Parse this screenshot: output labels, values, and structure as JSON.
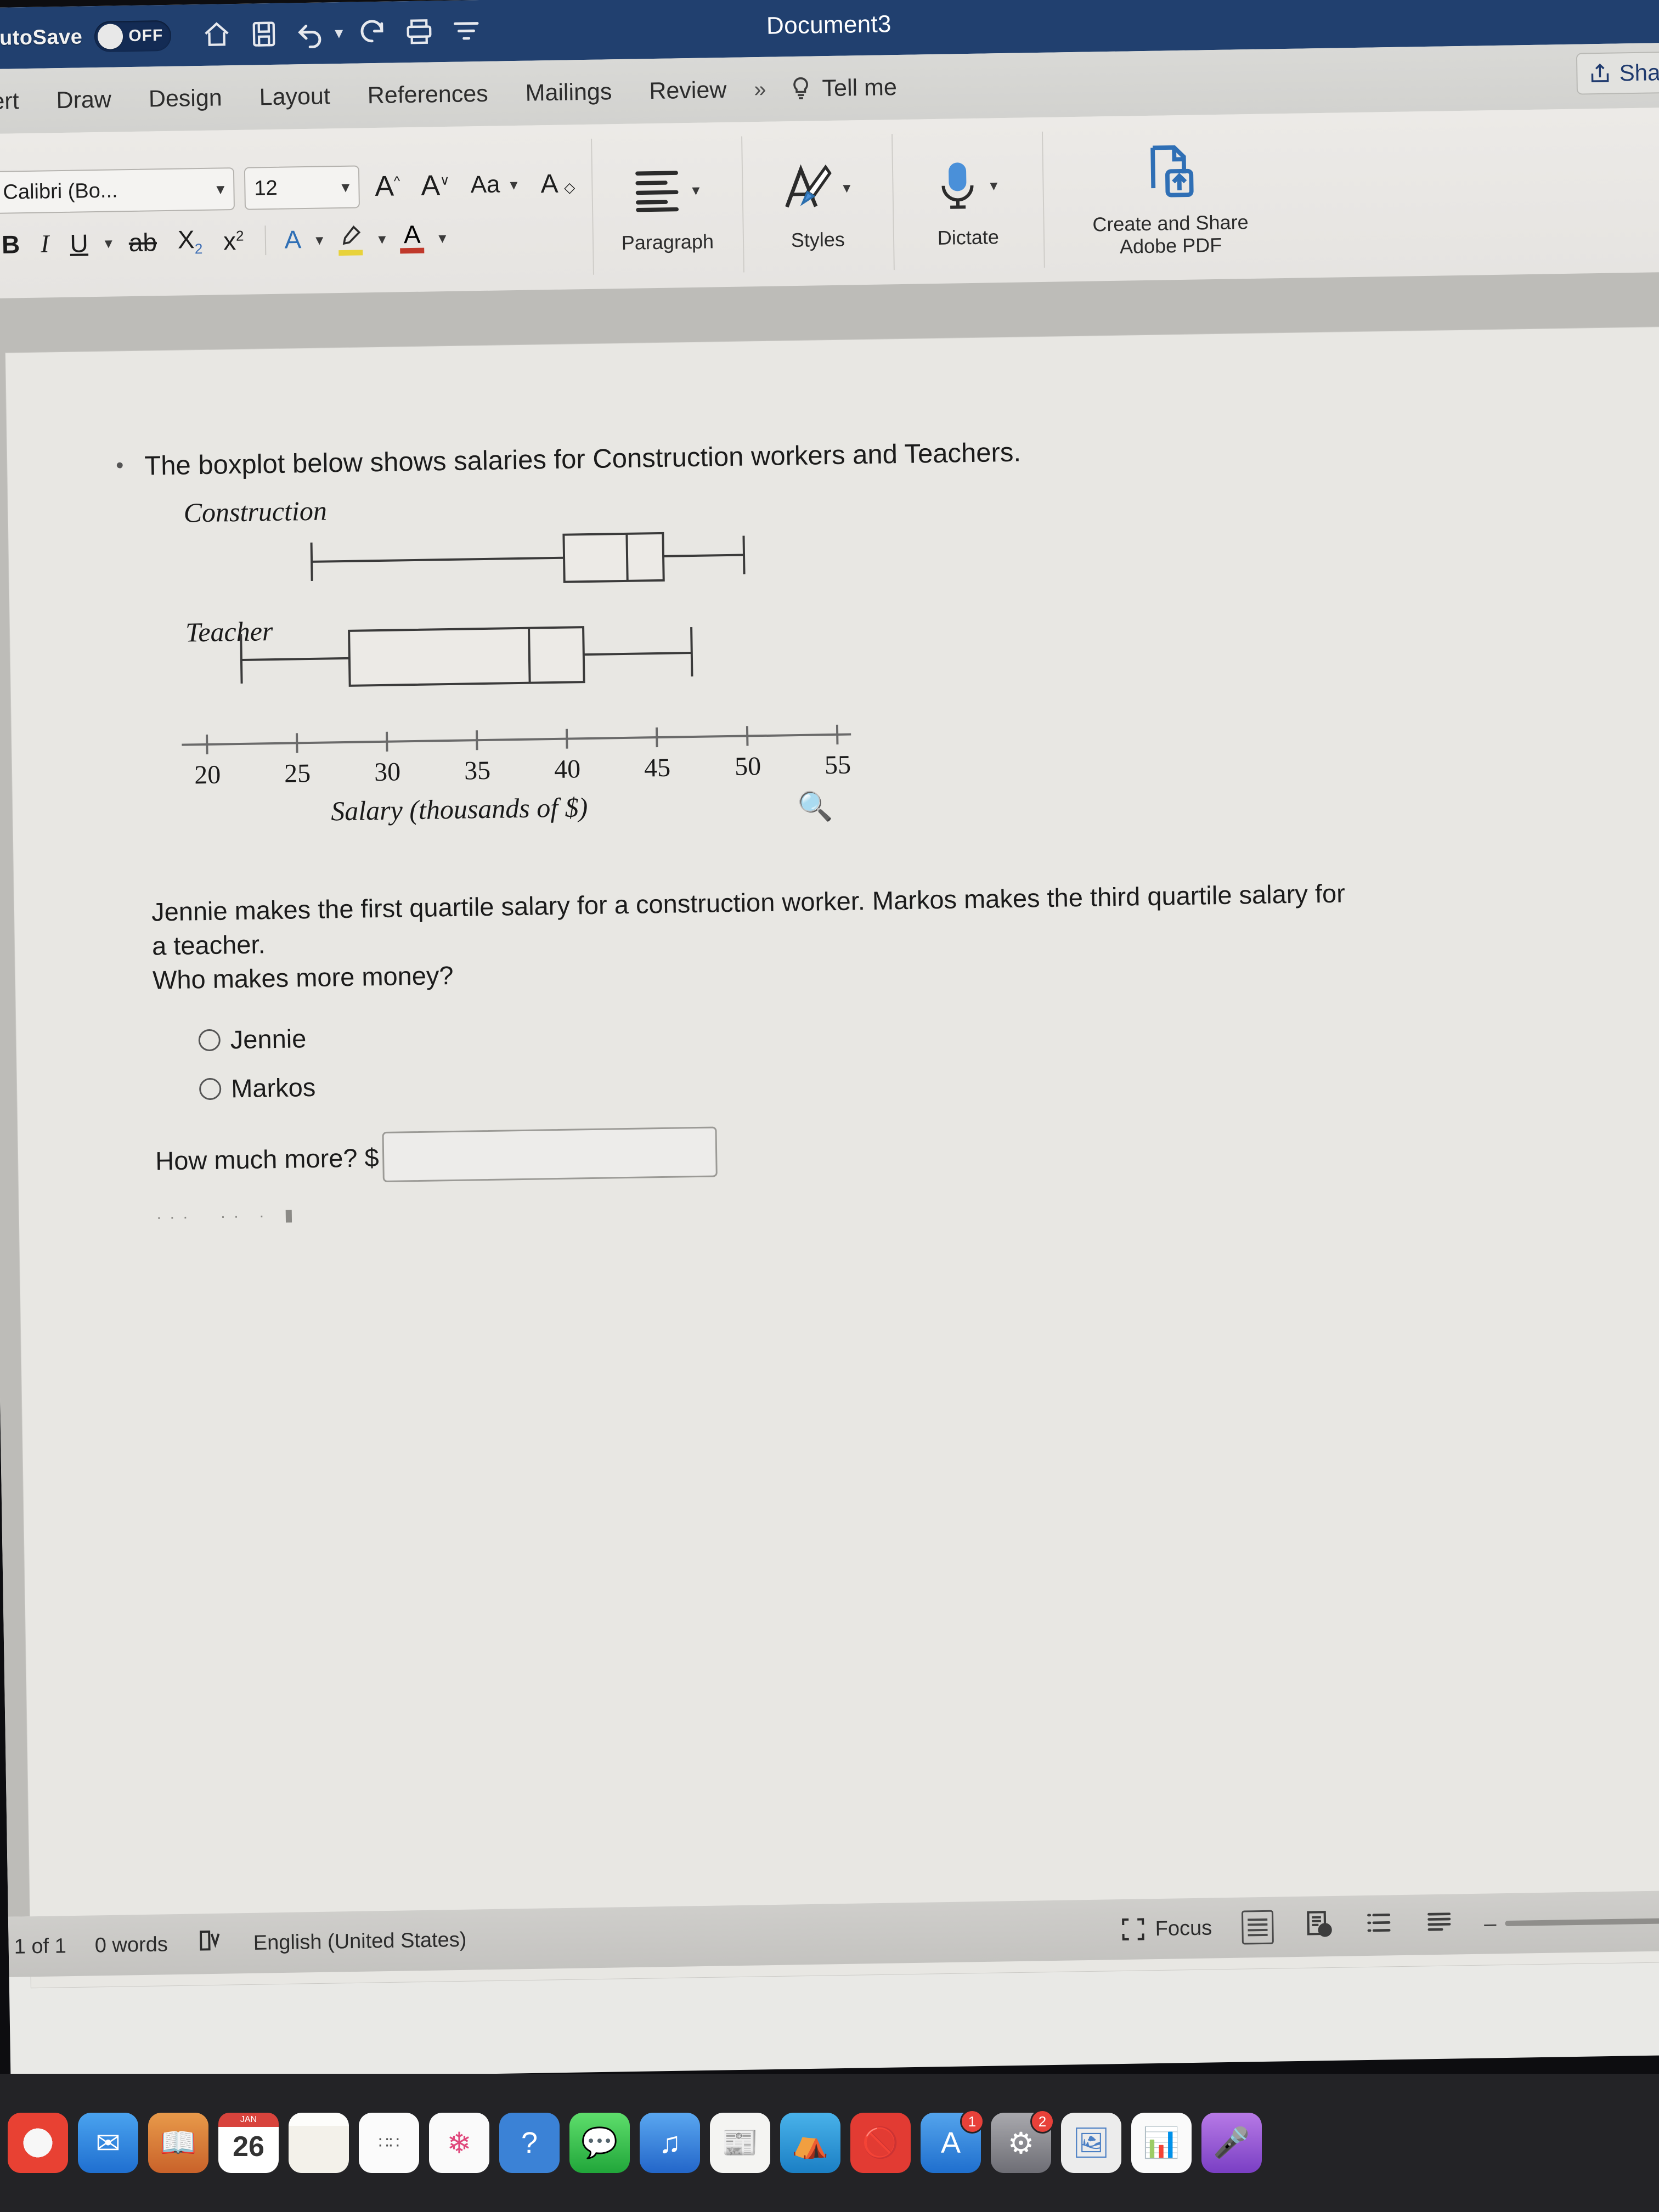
{
  "titlebar": {
    "autosave_label": "AutoSave",
    "toggle_state": "OFF",
    "document_title": "Document3",
    "icons": [
      "home-icon",
      "save-icon",
      "undo-icon",
      "redo-icon",
      "print-icon",
      "customize-toolbar-icon"
    ]
  },
  "tabs": [
    {
      "label": "sert"
    },
    {
      "label": "Draw"
    },
    {
      "label": "Design"
    },
    {
      "label": "Layout"
    },
    {
      "label": "References"
    },
    {
      "label": "Mailings"
    },
    {
      "label": "Review"
    }
  ],
  "tab_overflow": "»",
  "tell_me": "Tell me",
  "share_button": "Sha",
  "font_group": {
    "font_name": "Calibri (Bo...",
    "font_size": "12",
    "grow_font": "A",
    "shrink_font": "A",
    "change_case": "Aa",
    "clear_formatting": "A",
    "bold": "B",
    "italic": "I",
    "underline": "U",
    "strikethrough": "ab",
    "subscript": "X",
    "subscript_sub": "2",
    "superscript": "x",
    "superscript_sup": "2",
    "text_effects": "A",
    "highlight": "pen-icon",
    "font_color": "A"
  },
  "ribbon_groups": [
    {
      "label": "Paragraph",
      "icon": "paragraph-align-icon"
    },
    {
      "label": "Styles",
      "icon": "styles-brush-icon"
    },
    {
      "label": "Dictate",
      "icon": "microphone-icon"
    },
    {
      "label": "Create and Share\nAdobe PDF",
      "label_line1": "Create and Share",
      "label_line2": "Adobe PDF",
      "icon": "adobe-pdf-share-icon"
    }
  ],
  "document": {
    "intro": "The boxplot below shows salaries for Construction workers and Teachers.",
    "question_line1": "Jennie makes the first quartile salary for a construction worker. Markos makes the third quartile salary for",
    "question_line2": "a teacher.",
    "question_line3": "Who makes more money?",
    "choices": [
      {
        "label": "Jennie",
        "selected": false
      },
      {
        "label": "Markos",
        "selected": false
      }
    ],
    "how_much_label": "How much more? $",
    "answer_value": "",
    "answer_placeholder": ""
  },
  "chart_data": {
    "type": "boxplot",
    "title": "",
    "xlabel": "Salary (thousands of $)",
    "ylabel": "",
    "xlim": [
      18,
      57
    ],
    "ticks": [
      20,
      25,
      30,
      35,
      40,
      45,
      50,
      55
    ],
    "grid": false,
    "legend": "none",
    "series": [
      {
        "name": "Construction",
        "min": 26,
        "q1": 40,
        "median": 43.5,
        "q3": 45.5,
        "max": 50
      },
      {
        "name": "Teacher",
        "min": 22,
        "q1": 28,
        "median": 38,
        "q3": 41,
        "max": 47
      }
    ]
  },
  "statusbar": {
    "page": "1 of 1",
    "words": "0 words",
    "proofing_icon": "spell-check-icon",
    "language": "English (United States)",
    "focus": "Focus",
    "views": [
      "print-layout-icon",
      "web-layout-icon",
      "outline-icon",
      "draft-icon"
    ],
    "zoom_minus": "–",
    "zoom_level": ""
  },
  "dock": {
    "items": [
      {
        "name": "chrome-icon",
        "color": "#f5f5f5"
      },
      {
        "name": "mail-icon",
        "color": "#2e8bdd"
      },
      {
        "name": "books-icon",
        "color": "#e07a33"
      },
      {
        "name": "calendar-icon",
        "color": "#ffffff",
        "day": "26",
        "month": "JAN"
      },
      {
        "name": "notes-icon",
        "color": "#f3f3f3"
      },
      {
        "name": "reminders-icon",
        "color": "#fafafa"
      },
      {
        "name": "photos-icon",
        "color": "#f7f7f7"
      },
      {
        "name": "help-icon",
        "color": "#3b82d6"
      },
      {
        "name": "messages-icon",
        "color": "#2fbf4a"
      },
      {
        "name": "music-icon",
        "color": "#3b7fd4"
      },
      {
        "name": "news-icon",
        "color": "#f2f2f2"
      },
      {
        "name": "keynote-icon",
        "color": "#2c9bdc"
      },
      {
        "name": "blocker-icon",
        "color": "#e23b33"
      },
      {
        "name": "appstore-icon",
        "color": "#3c8ee0",
        "badge": "1"
      },
      {
        "name": "settings-icon",
        "color": "#8a8a8f",
        "badge": "2"
      },
      {
        "name": "preview-icon",
        "color": "#eaeaea"
      },
      {
        "name": "numbers-icon",
        "color": "#3fae52"
      },
      {
        "name": "podcast-icon",
        "color": "#9b5ad6"
      }
    ]
  }
}
